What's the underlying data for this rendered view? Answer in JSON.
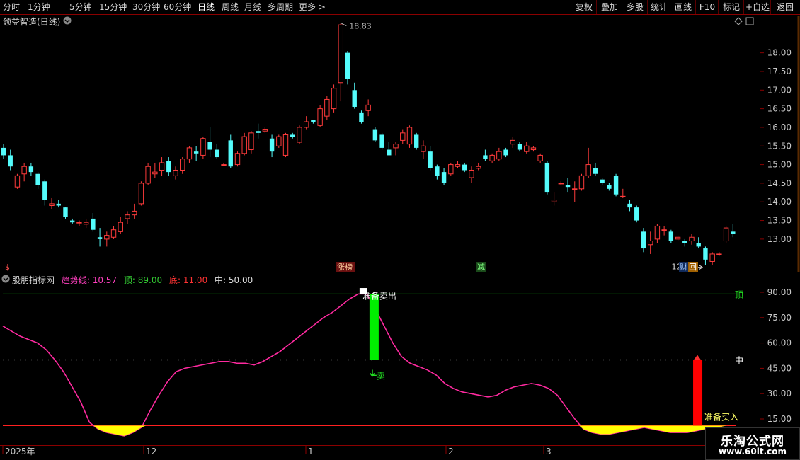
{
  "toolbar": {
    "periods": [
      "分时",
      "1分钟",
      "5分钟",
      "15分钟",
      "30分钟",
      "60分钟",
      "日线",
      "周线",
      "月线",
      "多周期",
      "更多 >"
    ],
    "active_period": "日线",
    "buttons": [
      "复权",
      "叠加",
      "多股",
      "统计",
      "画线",
      "F10",
      "标记",
      "+自选",
      "返回"
    ]
  },
  "main_chart": {
    "title": "领益智造(日线)",
    "price_labels": [
      "18.00",
      "17.50",
      "17.00",
      "16.50",
      "16.00",
      "15.50",
      "15.00",
      "14.50",
      "14.00",
      "13.50",
      "13.00"
    ],
    "high_label": "18.83",
    "low_label": "12.29",
    "markers": [
      "$",
      "涨榜",
      "减",
      "财",
      "回"
    ]
  },
  "indicator": {
    "name": "股朋指标网",
    "params": [
      {
        "label": "趋势线:",
        "value": "10.57",
        "color": "#ff3fbf"
      },
      {
        "label": "顶:",
        "value": "89.00",
        "color": "#33cc33"
      },
      {
        "label": "底:",
        "value": "11.00",
        "color": "#ff3333"
      },
      {
        "label": "中:",
        "value": "50.00",
        "color": "#dddddd"
      }
    ],
    "axis_labels": [
      "90.00",
      "75.00",
      "60.00",
      "45.00",
      "30.00",
      "15.00"
    ],
    "line_tags": {
      "top": "顶",
      "mid": "中"
    },
    "sell_prep": "准备卖出",
    "sell": "卖",
    "buy_prep": "准备买入"
  },
  "date_axis": [
    "2025年",
    "12",
    "1",
    "2",
    "3"
  ],
  "watermark": {
    "line1": "乐淘公式网",
    "line2": "www.60lt.com"
  },
  "colors": {
    "up": "#ff3b3b",
    "down": "#54fcfc",
    "border": "#8b0000",
    "trend": "#ff2aa0",
    "bottom_fill": "#ffff00",
    "buy_bar": "#ff0000",
    "sell_bar": "#00ee00"
  },
  "chart_data": [
    {
      "type": "candlestick",
      "title": "领益智造(日线)",
      "ylim": [
        12.2,
        19.0
      ],
      "ohlc": [
        [
          15.45,
          15.55,
          15.15,
          15.25
        ],
        [
          15.25,
          15.4,
          14.85,
          14.95
        ],
        [
          14.4,
          14.75,
          14.35,
          14.7
        ],
        [
          14.75,
          15.05,
          14.55,
          14.95
        ],
        [
          14.95,
          15.05,
          14.7,
          14.8
        ],
        [
          14.75,
          14.8,
          14.35,
          14.45
        ],
        [
          14.55,
          14.6,
          13.9,
          14.05
        ],
        [
          13.9,
          14.1,
          13.8,
          13.95
        ],
        [
          13.95,
          14.05,
          13.85,
          13.9
        ],
        [
          13.85,
          13.85,
          13.55,
          13.6
        ],
        [
          13.5,
          13.55,
          13.4,
          13.45
        ],
        [
          13.45,
          13.5,
          13.35,
          13.45
        ],
        [
          13.4,
          13.55,
          13.3,
          13.45
        ],
        [
          13.55,
          13.7,
          13.2,
          13.25
        ],
        [
          13.05,
          13.3,
          12.8,
          13.0
        ],
        [
          13.0,
          13.2,
          12.8,
          13.1
        ],
        [
          13.05,
          13.35,
          13.0,
          13.25
        ],
        [
          13.2,
          13.6,
          13.15,
          13.45
        ],
        [
          13.55,
          13.75,
          13.4,
          13.65
        ],
        [
          13.65,
          13.95,
          13.55,
          13.75
        ],
        [
          13.95,
          14.55,
          13.9,
          14.5
        ],
        [
          14.5,
          15.05,
          14.45,
          14.95
        ],
        [
          14.75,
          15.05,
          14.65,
          14.8
        ],
        [
          14.85,
          15.2,
          14.7,
          15.05
        ],
        [
          15.1,
          15.2,
          14.7,
          14.8
        ],
        [
          14.7,
          14.95,
          14.6,
          14.85
        ],
        [
          14.85,
          15.2,
          14.75,
          15.15
        ],
        [
          15.15,
          15.5,
          15.05,
          15.45
        ],
        [
          15.35,
          15.5,
          15.1,
          15.3
        ],
        [
          15.25,
          15.75,
          15.15,
          15.7
        ],
        [
          15.6,
          16.0,
          15.2,
          15.4
        ],
        [
          15.4,
          15.55,
          15.15,
          15.2
        ],
        [
          15.0,
          15.05,
          15.0,
          15.0
        ],
        [
          15.65,
          15.8,
          14.9,
          14.95
        ],
        [
          15.0,
          15.35,
          14.95,
          15.3
        ],
        [
          15.3,
          15.85,
          15.25,
          15.75
        ],
        [
          15.4,
          15.9,
          15.3,
          15.85
        ],
        [
          15.9,
          16.1,
          15.7,
          15.85
        ],
        [
          15.9,
          16.0,
          15.85,
          15.95
        ],
        [
          15.7,
          15.8,
          15.2,
          15.35
        ],
        [
          15.5,
          15.8,
          15.45,
          15.75
        ],
        [
          15.25,
          15.85,
          15.2,
          15.8
        ],
        [
          15.8,
          15.85,
          15.7,
          15.75
        ],
        [
          15.6,
          16.05,
          15.55,
          16.0
        ],
        [
          16.0,
          16.3,
          15.95,
          16.15
        ],
        [
          16.2,
          16.2,
          16.1,
          16.15
        ],
        [
          16.05,
          16.6,
          16.0,
          16.5
        ],
        [
          16.3,
          16.85,
          16.2,
          16.75
        ],
        [
          16.5,
          17.15,
          16.4,
          17.05
        ],
        [
          17.2,
          18.8,
          16.7,
          18.75
        ],
        [
          18.0,
          18.05,
          17.15,
          17.3
        ],
        [
          17.0,
          17.2,
          16.5,
          16.55
        ],
        [
          16.4,
          16.45,
          16.1,
          16.15
        ],
        [
          16.45,
          16.75,
          16.3,
          16.6
        ],
        [
          15.95,
          16.0,
          15.6,
          15.65
        ],
        [
          15.8,
          15.85,
          15.4,
          15.45
        ],
        [
          15.4,
          15.6,
          15.25,
          15.25
        ],
        [
          15.45,
          15.6,
          15.25,
          15.55
        ],
        [
          15.65,
          15.95,
          15.55,
          15.85
        ],
        [
          15.55,
          16.05,
          15.45,
          16.0
        ],
        [
          15.8,
          15.85,
          15.4,
          15.45
        ],
        [
          15.35,
          15.65,
          15.15,
          15.5
        ],
        [
          15.35,
          15.5,
          14.85,
          14.9
        ],
        [
          14.95,
          15.0,
          14.6,
          14.7
        ],
        [
          14.8,
          14.9,
          14.45,
          14.5
        ],
        [
          14.75,
          15.05,
          14.7,
          15.0
        ],
        [
          14.95,
          15.1,
          14.9,
          15.0
        ],
        [
          15.0,
          15.05,
          14.8,
          14.85
        ],
        [
          14.65,
          14.95,
          14.5,
          14.85
        ],
        [
          14.9,
          15.05,
          14.85,
          14.95
        ],
        [
          15.25,
          15.4,
          15.1,
          15.15
        ],
        [
          15.1,
          15.3,
          15.05,
          15.25
        ],
        [
          15.15,
          15.45,
          15.1,
          15.35
        ],
        [
          15.4,
          15.45,
          15.2,
          15.25
        ],
        [
          15.55,
          15.75,
          15.45,
          15.65
        ],
        [
          15.55,
          15.6,
          15.35,
          15.4
        ],
        [
          15.35,
          15.6,
          15.3,
          15.5
        ],
        [
          15.4,
          15.5,
          15.35,
          15.45
        ],
        [
          15.1,
          15.3,
          15.05,
          15.25
        ],
        [
          15.05,
          15.1,
          14.2,
          14.25
        ],
        [
          14.0,
          14.25,
          13.9,
          14.05
        ],
        [
          14.5,
          14.55,
          14.45,
          14.5
        ],
        [
          14.45,
          14.65,
          14.25,
          14.4
        ],
        [
          14.35,
          14.55,
          14.0,
          14.35
        ],
        [
          14.35,
          14.75,
          14.3,
          14.7
        ],
        [
          14.7,
          15.45,
          14.65,
          15.0
        ],
        [
          14.9,
          15.05,
          14.7,
          14.75
        ],
        [
          14.6,
          14.65,
          14.45,
          14.5
        ],
        [
          14.45,
          14.5,
          14.3,
          14.35
        ],
        [
          14.7,
          14.75,
          14.15,
          14.2
        ],
        [
          14.15,
          14.35,
          14.1,
          14.15
        ],
        [
          13.95,
          14.05,
          13.75,
          13.85
        ],
        [
          13.85,
          13.9,
          13.45,
          13.5
        ],
        [
          13.2,
          13.3,
          12.65,
          12.75
        ],
        [
          12.85,
          13.2,
          12.6,
          12.95
        ],
        [
          13.0,
          13.4,
          12.9,
          13.35
        ],
        [
          13.25,
          13.35,
          13.1,
          13.25
        ],
        [
          13.2,
          13.25,
          12.9,
          12.95
        ],
        [
          13.0,
          13.1,
          12.95,
          13.05
        ],
        [
          12.95,
          13.0,
          12.8,
          12.9
        ],
        [
          12.95,
          13.15,
          12.85,
          13.05
        ],
        [
          12.9,
          13.05,
          12.75,
          12.8
        ],
        [
          12.75,
          12.8,
          12.3,
          12.45
        ],
        [
          12.4,
          12.65,
          12.3,
          12.6
        ],
        [
          12.6,
          12.65,
          12.55,
          12.6
        ],
        [
          12.95,
          13.35,
          12.9,
          13.3
        ],
        [
          13.2,
          13.4,
          13.05,
          13.15
        ]
      ]
    },
    {
      "type": "line",
      "name": "股朋指标网",
      "ylim": [
        0,
        100
      ],
      "series": [
        {
          "name": "趋势线",
          "values": [
            70,
            67,
            64,
            62,
            60,
            56,
            50,
            43,
            34,
            25,
            13,
            9,
            7,
            6,
            5,
            7,
            10,
            20,
            29,
            37,
            43,
            45,
            46,
            47,
            48,
            49,
            49,
            48,
            48,
            47,
            49,
            52,
            55,
            59,
            63,
            67,
            71,
            75,
            78,
            82,
            86,
            89,
            89,
            80,
            70,
            60,
            52,
            48,
            46,
            44,
            41,
            36,
            33,
            31,
            30,
            29,
            28,
            29,
            32,
            34,
            35,
            36,
            35,
            33,
            29,
            22,
            15,
            9,
            7,
            6,
            6,
            7,
            8,
            9,
            10,
            9,
            8,
            7,
            7,
            7,
            8,
            9,
            10,
            10.57
          ]
        },
        {
          "name": "顶",
          "values": [
            89
          ]
        },
        {
          "name": "底",
          "values": [
            11
          ]
        },
        {
          "name": "中",
          "values": [
            50
          ]
        }
      ]
    }
  ]
}
